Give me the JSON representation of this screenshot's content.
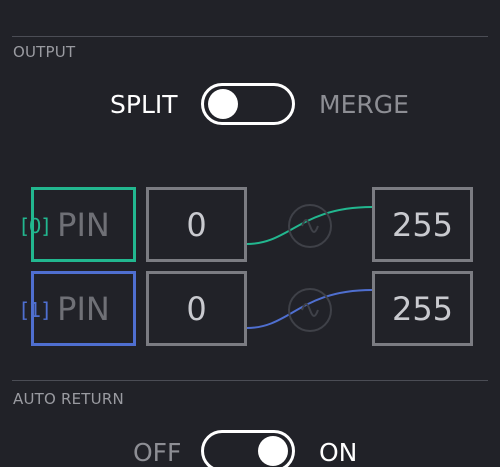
{
  "output": {
    "section_label": "OUTPUT",
    "mode_toggle": {
      "left_label": "SPLIT",
      "right_label": "MERGE",
      "selected": "SPLIT"
    },
    "channels": [
      {
        "index_label": "[0]",
        "pin_label": "PIN",
        "min_value": "0",
        "max_value": "255",
        "color": "#22b78f"
      },
      {
        "index_label": "[1]",
        "pin_label": "PIN",
        "min_value": "0",
        "max_value": "255",
        "color": "#4f6fd0"
      }
    ],
    "wave_icon": "sine-wave-icon"
  },
  "auto_return": {
    "section_label": "AUTO RETURN",
    "toggle": {
      "left_label": "OFF",
      "right_label": "ON",
      "selected": "ON"
    }
  },
  "colors": {
    "background": "#212228",
    "divider": "#4b4d55",
    "box_border": "#7b7c82",
    "channel_0": "#22b78f",
    "channel_1": "#4f6fd0"
  }
}
